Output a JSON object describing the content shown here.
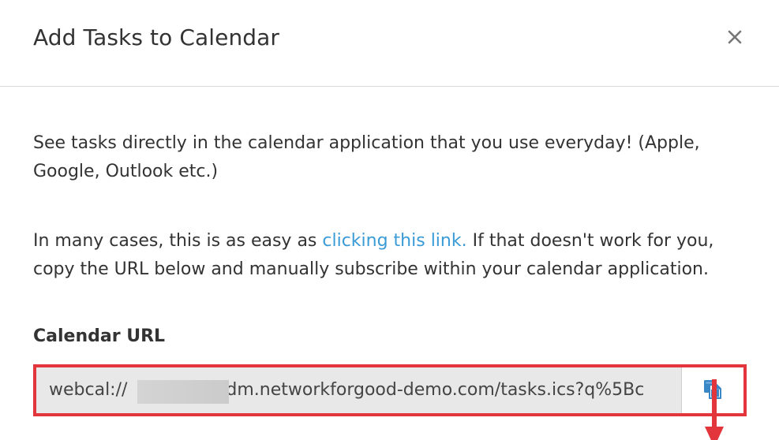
{
  "modal": {
    "title": "Add Tasks to Calendar",
    "close_icon": "close-icon"
  },
  "body": {
    "intro": "See tasks directly in the calendar application that you use everyday! (Apple, Google, Outlook etc.)",
    "instructions": {
      "before_link": "In many cases, this is as easy as ",
      "link_text": "clicking this link.",
      "after_link": " If that doesn't work for you, copy the URL below and manually subscribe within your calendar application."
    },
    "calendar_url": {
      "label": "Calendar URL",
      "value_prefix": "webcal://",
      "value_suffix": ".dm.networkforgood-demo.com/tasks.ics?q%5Bc",
      "copy_icon": "copy-icon"
    }
  },
  "colors": {
    "link": "#3a9bd6",
    "highlight": "#e3353c",
    "copy_icon": "#3a87c8",
    "input_bg": "#e8e8e8"
  }
}
